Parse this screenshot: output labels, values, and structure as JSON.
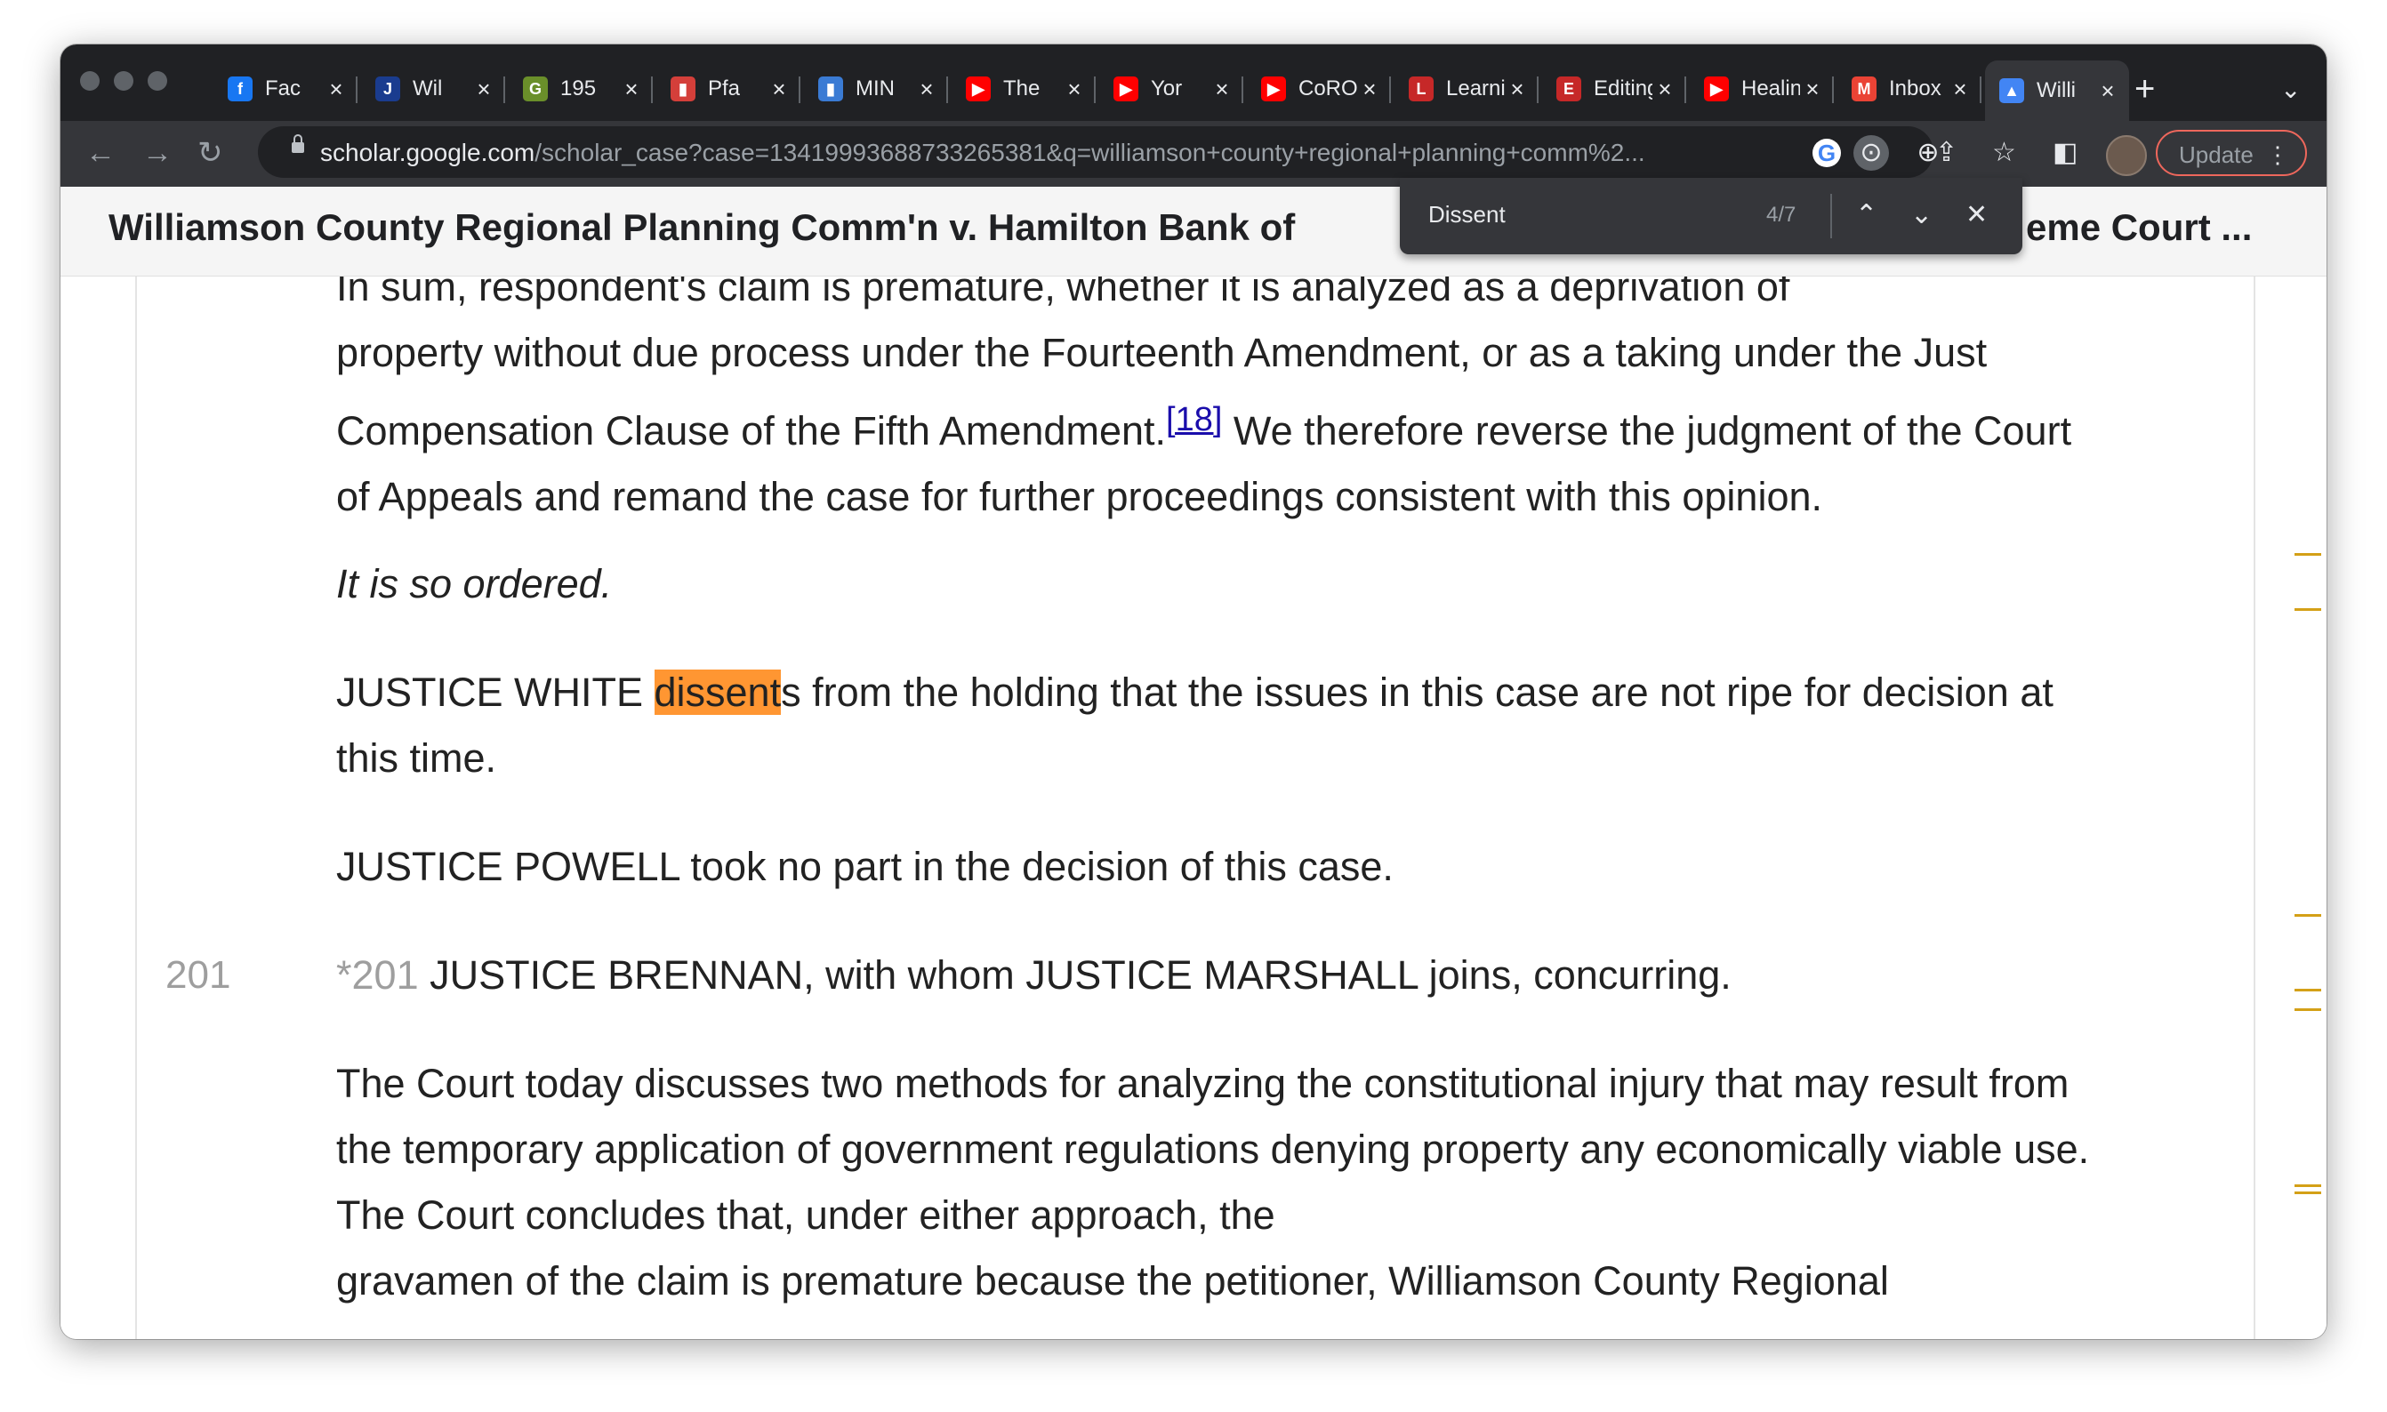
{
  "tabs": [
    {
      "title": "Fac",
      "icon": "facebook-icon",
      "color": "#1877f2",
      "glyph": "f"
    },
    {
      "title": "Wil",
      "icon": "justia-icon",
      "color": "#1a3c8f",
      "glyph": "J"
    },
    {
      "title": "195",
      "icon": "gun-site-icon",
      "color": "#6a8f2a",
      "glyph": "G"
    },
    {
      "title": "Pfa",
      "icon": "bars-icon",
      "color": "#d43f3a",
      "glyph": "▮"
    },
    {
      "title": "MIN",
      "icon": "bars-icon",
      "color": "#3a7bd4",
      "glyph": "▮"
    },
    {
      "title": "The",
      "icon": "youtube-icon",
      "color": "#ff0000",
      "glyph": "▶"
    },
    {
      "title": "Yor",
      "icon": "youtube-icon",
      "color": "#ff0000",
      "glyph": "▶"
    },
    {
      "title": "CoROE",
      "icon": "youtube-icon",
      "color": "#ff0000",
      "glyph": "▶"
    },
    {
      "title": "Learnin",
      "icon": "course-icon",
      "color": "#c62828",
      "glyph": "L"
    },
    {
      "title": "Editing",
      "icon": "course-icon",
      "color": "#c62828",
      "glyph": "E"
    },
    {
      "title": "Healing",
      "icon": "youtube-icon",
      "color": "#ff0000",
      "glyph": "▶"
    },
    {
      "title": "Inbox (",
      "icon": "gmail-icon",
      "color": "#ea4335",
      "glyph": "M"
    },
    {
      "title": "Willi",
      "icon": "scholar-icon",
      "color": "#4285f4",
      "glyph": "▲",
      "active": true
    }
  ],
  "toolbar": {
    "url_host": "scholar.google.com",
    "url_path": "/scholar_case?case=13419993688733265381&q=williamson+county+regional+planning+comm%2...",
    "update_label": "Update"
  },
  "page": {
    "title_left": "Williamson County Regional Planning Comm'n v. Hamilton Bank of",
    "title_right": "eme Court ..."
  },
  "find": {
    "query": "Dissent",
    "count": "4/7"
  },
  "opinion": {
    "p1_top": "In sum, respondent's claim is premature, whether it is analyzed as a deprivation of",
    "p1a": "property without due process under the Fourteenth Amendment, or as a taking under the Just Compensation Clause of the Fifth Amendment.",
    "footnote": "[18]",
    "p1b": " We therefore reverse the judgment of the Court of Appeals and remand the case for further proceedings consistent with this opinion.",
    "p2": "It is so ordered.",
    "p3a": "JUSTICE WHITE ",
    "p3_hl": "dissent",
    "p3b": "s from the holding that the issues in this case are not ripe for decision at this time.",
    "p4": "JUSTICE POWELL took no part in the decision of this case.",
    "page_number": "201",
    "page_marker": "*201",
    "p5": " JUSTICE BRENNAN, with whom JUSTICE MARSHALL joins, concurring.",
    "p6": "The Court today discusses two methods for analyzing the constitutional injury that may result from the temporary application of government regulations denying property any economically viable use. The Court concludes that, under either approach, the",
    "p6_cut": "gravamen of the claim is premature because the petitioner, Williamson County Regional"
  }
}
